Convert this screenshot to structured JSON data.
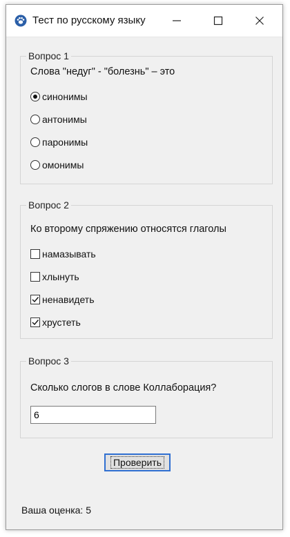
{
  "window": {
    "title": "Тест по русскому языку",
    "app_icon": "paw-icon",
    "controls": [
      "minimize-icon",
      "maximize-icon",
      "close-icon"
    ]
  },
  "question1": {
    "legend": "Вопрос 1",
    "text": "Слова \"недуг\" - \"болезнь\" – это",
    "options": [
      {
        "label": "синонимы",
        "checked": true
      },
      {
        "label": "антонимы",
        "checked": false
      },
      {
        "label": "паронимы",
        "checked": false
      },
      {
        "label": "омонимы",
        "checked": false
      }
    ]
  },
  "question2": {
    "legend": "Вопрос 2",
    "text": "Ко второму спряжению относятся глаголы",
    "options": [
      {
        "label": "намазывать",
        "checked": false
      },
      {
        "label": "хлынуть",
        "checked": false
      },
      {
        "label": "ненавидеть",
        "checked": true
      },
      {
        "label": "хрустеть",
        "checked": true
      }
    ]
  },
  "question3": {
    "legend": "Вопрос 3",
    "text": "Сколько слогов в слове Коллаборация?",
    "answer_value": "6"
  },
  "check_button": {
    "label": "Проверить"
  },
  "score": {
    "label": "Ваша оценка:",
    "value": "5"
  },
  "colors": {
    "focus_accent": "#2f6fd1",
    "window_bg": "#f0f0f0",
    "button_bg": "#e1e1e1"
  }
}
